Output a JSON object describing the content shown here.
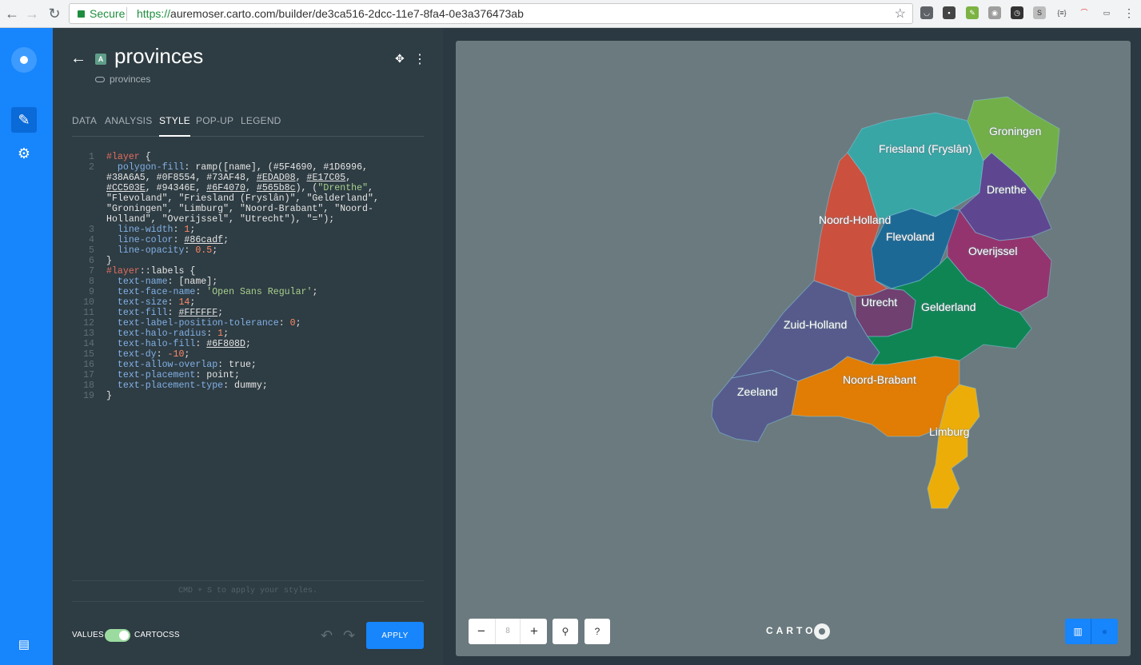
{
  "browser": {
    "secure_label": "Secure",
    "url_scheme": "https://",
    "url_host": "auremoser.carto.com",
    "url_path": "/builder/de3ca516-2dcc-11e7-8fa4-0e3a376473ab"
  },
  "layer": {
    "badge": "A",
    "title": "provinces",
    "source": "provinces"
  },
  "tabs": [
    "DATA",
    "ANALYSIS",
    "STYLE",
    "POP-UP",
    "LEGEND"
  ],
  "active_tab": "STYLE",
  "code_lines": [
    {
      "n": "1",
      "parts": [
        [
          "sel",
          "#layer"
        ],
        [
          "",
          " {"
        ]
      ]
    },
    {
      "n": "2",
      "parts": [
        [
          "",
          "  "
        ],
        [
          "prop",
          "polygon-fill"
        ],
        [
          "",
          ": ramp([name], (#5F4690, #1D6996,"
        ]
      ]
    },
    {
      "n": "",
      "parts": [
        [
          "",
          "#38A6A5, #0F8554, #73AF48, "
        ],
        [
          "col",
          "#EDAD08"
        ],
        [
          "",
          ", "
        ],
        [
          "col",
          "#E17C05"
        ],
        [
          "",
          ","
        ]
      ]
    },
    {
      "n": "",
      "parts": [
        [
          "col",
          "#CC503E"
        ],
        [
          "",
          ", #94346E, "
        ],
        [
          "col",
          "#6F4070"
        ],
        [
          "",
          ", "
        ],
        [
          "col",
          "#565b8c"
        ],
        [
          "",
          "), ("
        ],
        [
          "str",
          "\"Drenthe\""
        ],
        [
          "",
          ","
        ]
      ]
    },
    {
      "n": "",
      "parts": [
        [
          "",
          "\"Flevoland\", \"Friesland (Fryslân)\", \"Gelderland\","
        ]
      ]
    },
    {
      "n": "",
      "parts": [
        [
          "",
          "\"Groningen\", \"Limburg\", \"Noord-Brabant\", \"Noord-"
        ]
      ]
    },
    {
      "n": "",
      "parts": [
        [
          "",
          "Holland\", \"Overijssel\", \"Utrecht\"), \"=\");"
        ]
      ]
    },
    {
      "n": "3",
      "parts": [
        [
          "",
          "  "
        ],
        [
          "prop",
          "line-width"
        ],
        [
          "",
          ": "
        ],
        [
          "num",
          "1"
        ],
        [
          "",
          ";"
        ]
      ]
    },
    {
      "n": "4",
      "parts": [
        [
          "",
          "  "
        ],
        [
          "prop",
          "line-color"
        ],
        [
          "",
          ": "
        ],
        [
          "col",
          "#86cadf"
        ],
        [
          "",
          ";"
        ]
      ]
    },
    {
      "n": "5",
      "parts": [
        [
          "",
          "  "
        ],
        [
          "prop",
          "line-opacity"
        ],
        [
          "",
          ": "
        ],
        [
          "num",
          "0.5"
        ],
        [
          "",
          ";"
        ]
      ]
    },
    {
      "n": "6",
      "parts": [
        [
          "",
          "}"
        ]
      ]
    },
    {
      "n": "7",
      "parts": [
        [
          "sel",
          "#layer"
        ],
        [
          "",
          "::labels {"
        ]
      ]
    },
    {
      "n": "8",
      "parts": [
        [
          "",
          "  "
        ],
        [
          "prop",
          "text-name"
        ],
        [
          "",
          ": [name];"
        ]
      ]
    },
    {
      "n": "9",
      "parts": [
        [
          "",
          "  "
        ],
        [
          "prop",
          "text-face-name"
        ],
        [
          "",
          ": "
        ],
        [
          "str",
          "'Open Sans Regular'"
        ],
        [
          "",
          ";"
        ]
      ]
    },
    {
      "n": "10",
      "parts": [
        [
          "",
          "  "
        ],
        [
          "prop",
          "text-size"
        ],
        [
          "",
          ": "
        ],
        [
          "num",
          "14"
        ],
        [
          "",
          ";"
        ]
      ]
    },
    {
      "n": "11",
      "parts": [
        [
          "",
          "  "
        ],
        [
          "prop",
          "text-fill"
        ],
        [
          "",
          ": "
        ],
        [
          "col",
          "#FFFFFF"
        ],
        [
          "",
          ";"
        ]
      ]
    },
    {
      "n": "12",
      "parts": [
        [
          "",
          "  "
        ],
        [
          "prop",
          "text-label-position-tolerance"
        ],
        [
          "",
          ": "
        ],
        [
          "num",
          "0"
        ],
        [
          "",
          ";"
        ]
      ]
    },
    {
      "n": "13",
      "parts": [
        [
          "",
          "  "
        ],
        [
          "prop",
          "text-halo-radius"
        ],
        [
          "",
          ": "
        ],
        [
          "num",
          "1"
        ],
        [
          "",
          ";"
        ]
      ]
    },
    {
      "n": "14",
      "parts": [
        [
          "",
          "  "
        ],
        [
          "prop",
          "text-halo-fill"
        ],
        [
          "",
          ": "
        ],
        [
          "col",
          "#6F808D"
        ],
        [
          "",
          ";"
        ]
      ]
    },
    {
      "n": "15",
      "parts": [
        [
          "",
          "  "
        ],
        [
          "prop",
          "text-dy"
        ],
        [
          "",
          ": "
        ],
        [
          "num",
          "-10"
        ],
        [
          "",
          ";"
        ]
      ]
    },
    {
      "n": "16",
      "parts": [
        [
          "",
          "  "
        ],
        [
          "prop",
          "text-allow-overlap"
        ],
        [
          "",
          ": true;"
        ]
      ]
    },
    {
      "n": "17",
      "parts": [
        [
          "",
          "  "
        ],
        [
          "prop",
          "text-placement"
        ],
        [
          "",
          ": point;"
        ]
      ]
    },
    {
      "n": "18",
      "parts": [
        [
          "",
          "  "
        ],
        [
          "prop",
          "text-placement-type"
        ],
        [
          "",
          ": dummy;"
        ]
      ]
    },
    {
      "n": "19",
      "parts": [
        [
          "",
          "}"
        ]
      ]
    }
  ],
  "editor_hint": "CMD + S to apply your styles.",
  "footer": {
    "values_label": "VALUES",
    "cartocss_label": "CARTOCSS",
    "toggle_on": true,
    "apply_label": "APPLY"
  },
  "map": {
    "zoom_level": "8",
    "zoom_out": "−",
    "zoom_in": "+",
    "search_icon": "search-icon",
    "help_label": "?",
    "brand": "CARTO",
    "provinces": [
      {
        "name": "Groningen",
        "color": "#73AF48"
      },
      {
        "name": "Friesland (Fryslân)",
        "color": "#38A6A5"
      },
      {
        "name": "Drenthe",
        "color": "#5F4690"
      },
      {
        "name": "Noord-Holland",
        "color": "#CC503E"
      },
      {
        "name": "Flevoland",
        "color": "#1D6996"
      },
      {
        "name": "Overijssel",
        "color": "#94346E"
      },
      {
        "name": "Utrecht",
        "color": "#6F4070"
      },
      {
        "name": "Gelderland",
        "color": "#0F8554"
      },
      {
        "name": "Zuid-Holland",
        "color": "#565b8c"
      },
      {
        "name": "Zeeland",
        "color": "#565b8c"
      },
      {
        "name": "Noord-Brabant",
        "color": "#E17C05"
      },
      {
        "name": "Limburg",
        "color": "#EDAD08"
      }
    ]
  },
  "colors": {
    "accent": "#1785fb",
    "panel_bg": "#2e3c43",
    "map_bg": "#6b7a7f"
  }
}
